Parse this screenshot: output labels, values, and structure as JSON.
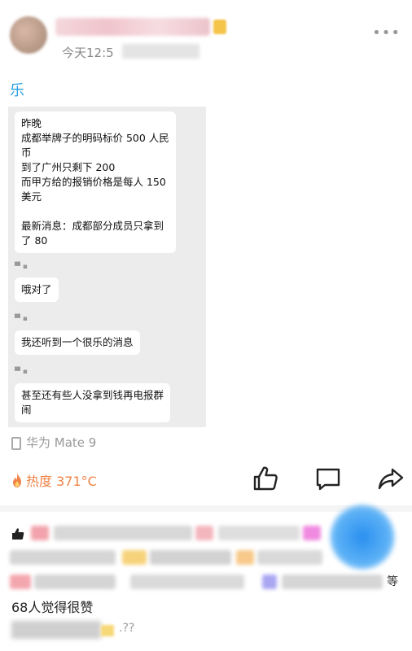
{
  "post": {
    "time": "今天12:5",
    "title": "乐",
    "device": "华为 Mate 9"
  },
  "chat": {
    "messages": [
      {
        "lines": [
          "昨晚",
          "成都举牌子的明码标价 500 人民",
          "币",
          "到了广州只剩下 200",
          "而甲方给的报销价格是每人 150",
          "美元",
          "",
          "最新消息：成都部分成员只拿到",
          "了 80"
        ]
      },
      {
        "lines": [
          "哦对了"
        ]
      },
      {
        "lines": [
          "我还听到一个很乐的消息"
        ]
      },
      {
        "lines": [
          "甚至还有些人没拿到钱再电报群",
          "闹"
        ]
      }
    ]
  },
  "actions": {
    "heat_label": "热度 371°C",
    "icons": [
      "thumbs-up-icon",
      "comment-icon",
      "share-icon"
    ]
  },
  "likes": {
    "suffix": "等",
    "count_text": "68人觉得很赞"
  },
  "comment": {
    "tail": ".??"
  },
  "colors": {
    "accent_blue": "#2b9fe6",
    "heat_orange": "#f08447"
  }
}
